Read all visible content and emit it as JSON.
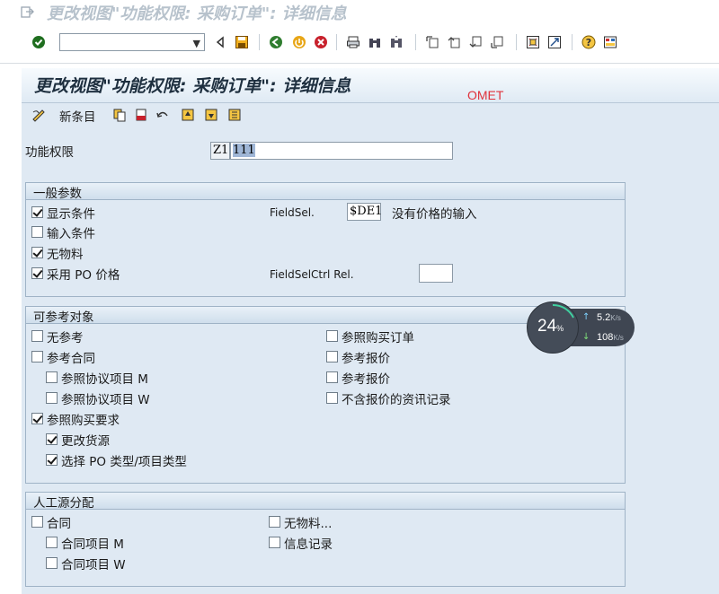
{
  "window": {
    "title": "更改视图\"功能权限: 采购订单\": 详细信息"
  },
  "toolbar": {
    "command_value": ""
  },
  "screen": {
    "title": "更改视图\"功能权限: 采购订单\": 详细信息",
    "overlay_text": "OMET"
  },
  "app_toolbar": {
    "new_entries": "新条目"
  },
  "key": {
    "label": "功能权限",
    "prefix": "Z1",
    "value": "111"
  },
  "general": {
    "title": "一般参数",
    "display_conditions": {
      "label": "显示条件",
      "checked": true
    },
    "input_conditions": {
      "label": "输入条件",
      "checked": false
    },
    "no_material": {
      "label": "无物料",
      "checked": true
    },
    "use_po_price": {
      "label": "采用 PO 价格",
      "checked": true
    },
    "fieldsel_label": "FieldSel.",
    "fieldsel_value": "$DE1",
    "fieldsel_desc": "没有价格的输入",
    "fieldselctrl_label": "FieldSelCtrl Rel.",
    "fieldselctrl_value": ""
  },
  "reference": {
    "title": "可参考对象",
    "left": [
      {
        "label": "无参考",
        "checked": false
      },
      {
        "label": "参考合同",
        "checked": false
      },
      {
        "label": "参照协议项目 M",
        "checked": false
      },
      {
        "label": "参照协议项目 W",
        "checked": false
      },
      {
        "label": "参照购买要求",
        "checked": true
      },
      {
        "label": "更改货源",
        "checked": true
      },
      {
        "label": "选择 PO 类型/项目类型",
        "checked": true
      }
    ],
    "right": [
      {
        "label": "参照购买订单",
        "checked": false
      },
      {
        "label": "参考报价",
        "checked": false
      },
      {
        "label": "参考报价",
        "checked": false
      },
      {
        "label": " 不含报价的资讯记录",
        "checked": false
      }
    ]
  },
  "manual": {
    "title": "人工源分配",
    "left": [
      {
        "label": "合同",
        "checked": false
      },
      {
        "label": "合同项目 M",
        "checked": false
      },
      {
        "label": "合同项目 W",
        "checked": false
      }
    ],
    "right": [
      {
        "label": "无物料...",
        "checked": false
      },
      {
        "label": "信息记录",
        "checked": false
      }
    ]
  },
  "speed_widget": {
    "percent": "24",
    "percent_unit": "%",
    "up": "5.2",
    "down": "108",
    "unit": "K/s"
  },
  "colors": {
    "panel": "#dfe9f3",
    "accent_red": "#e0323c"
  }
}
